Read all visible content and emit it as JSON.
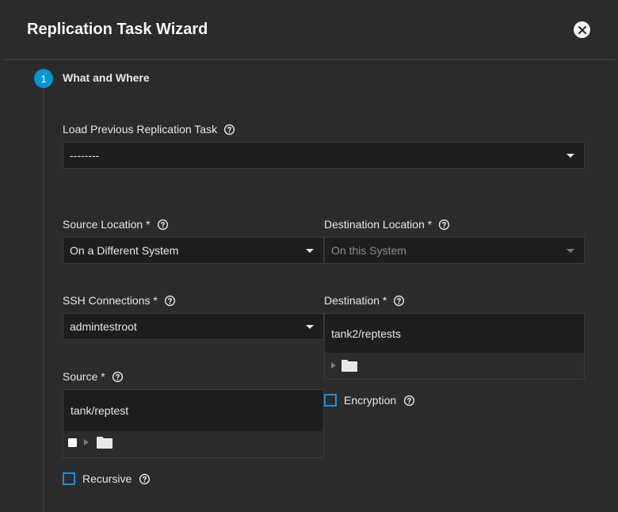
{
  "dialog": {
    "title": "Replication Task Wizard"
  },
  "step": {
    "number": "1",
    "label": "What and Where"
  },
  "load_previous": {
    "label": "Load Previous Replication Task",
    "value": "--------"
  },
  "source_location": {
    "label": "Source Location *",
    "value": "On a Different System"
  },
  "destination_location": {
    "label": "Destination Location *",
    "value": "On this System"
  },
  "ssh_connections": {
    "label": "SSH Connections *",
    "value": "admintestroot"
  },
  "destination": {
    "label": "Destination *",
    "value": "tank2/reptests"
  },
  "source": {
    "label": "Source *",
    "value": "tank/reptest"
  },
  "encryption": {
    "label": "Encryption"
  },
  "recursive": {
    "label": "Recursive"
  },
  "colors": {
    "accent": "#0095d5",
    "background": "#2b2b2b",
    "field_bg": "#1e1e1e",
    "checkbox_border": "#1b8fd6"
  }
}
